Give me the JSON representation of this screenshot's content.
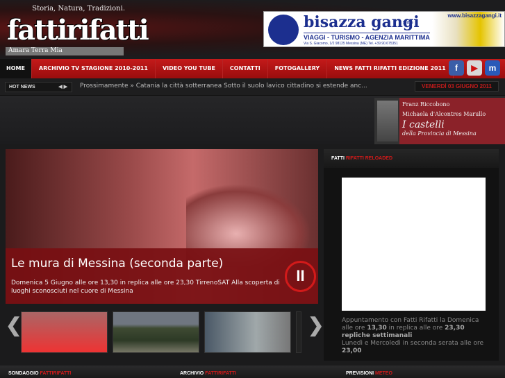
{
  "header": {
    "logo": {
      "tagline": "Storia, Natura, Tradizioni.",
      "name": "fattirifatti",
      "subtitle": "Amara Terra Mia"
    },
    "ad": {
      "name": "bisazza gangi",
      "suffix": "s.a.s",
      "services": "VIAGGI - TURISMO - AGENZIA MARITTIMA",
      "address": "Via S. Giacomo, 1/2 98125 Messina (ME) Tel. +39.90.675351",
      "url": "www.bisazzagangi.it"
    }
  },
  "nav": {
    "items": [
      "HOME",
      "ARCHIVIO TV STAGIONE 2010-2011",
      "VIDEO YOU TUBE",
      "CONTATTI",
      "FOTOGALLERY",
      "NEWS FATTI RIFATTI EDIZIONE 2011"
    ],
    "social": [
      {
        "icon": "facebook-icon",
        "glyph": "f",
        "color": "#3b5ea8"
      },
      {
        "icon": "youtube-icon",
        "glyph": "▶",
        "color": "#d8d8d8"
      },
      {
        "icon": "myspace-icon",
        "glyph": "m",
        "color": "#2a5ab8"
      }
    ]
  },
  "ticker": {
    "label": "HOT NEWS",
    "prev": "◀",
    "next": "▶",
    "text": "Prossimamente » Catania la città sotterranea Sotto il suolo lavico cittadino si estende anc...",
    "date": "VENERDÌ 03 GIUGNO 2011"
  },
  "castelli": {
    "author1": "Franz Riccobono",
    "author2": "Michaela d'Alcontres Marullo",
    "title": "I castelli",
    "subtitle": "della Provincia di Messina"
  },
  "slider": {
    "title": "Le mura di Messina (seconda parte)",
    "description": "Domenica 5 Giugno alle ore 13,30 in replica alle ore 23,30 TirrenoSAT Alla scoperta di luoghi sconosciuti nel cuore di Messina",
    "pause": "II",
    "prev": "❮",
    "next": "❯"
  },
  "widget": {
    "title_white": "FATTI",
    "title_red": "RIFATTI RELOADED",
    "text1": "Appuntamento con Fatti Rifatti la Domenica alle ore ",
    "time1": "13,30",
    "text2": " in replica alle ore ",
    "time2": "23,30",
    "highlight": "repliche settimanali",
    "text3": "Lunedì e Mercoledì in seconda serata  alle ore ",
    "time3": "23,00"
  },
  "bottom": [
    {
      "white": "SONDAGGIO",
      "red": "FATTIRIFATTI"
    },
    {
      "white": "ARCHIVIO",
      "red": "FATTIRIFATTI"
    },
    {
      "white": "PREVISIONI",
      "red": "METEO"
    }
  ]
}
